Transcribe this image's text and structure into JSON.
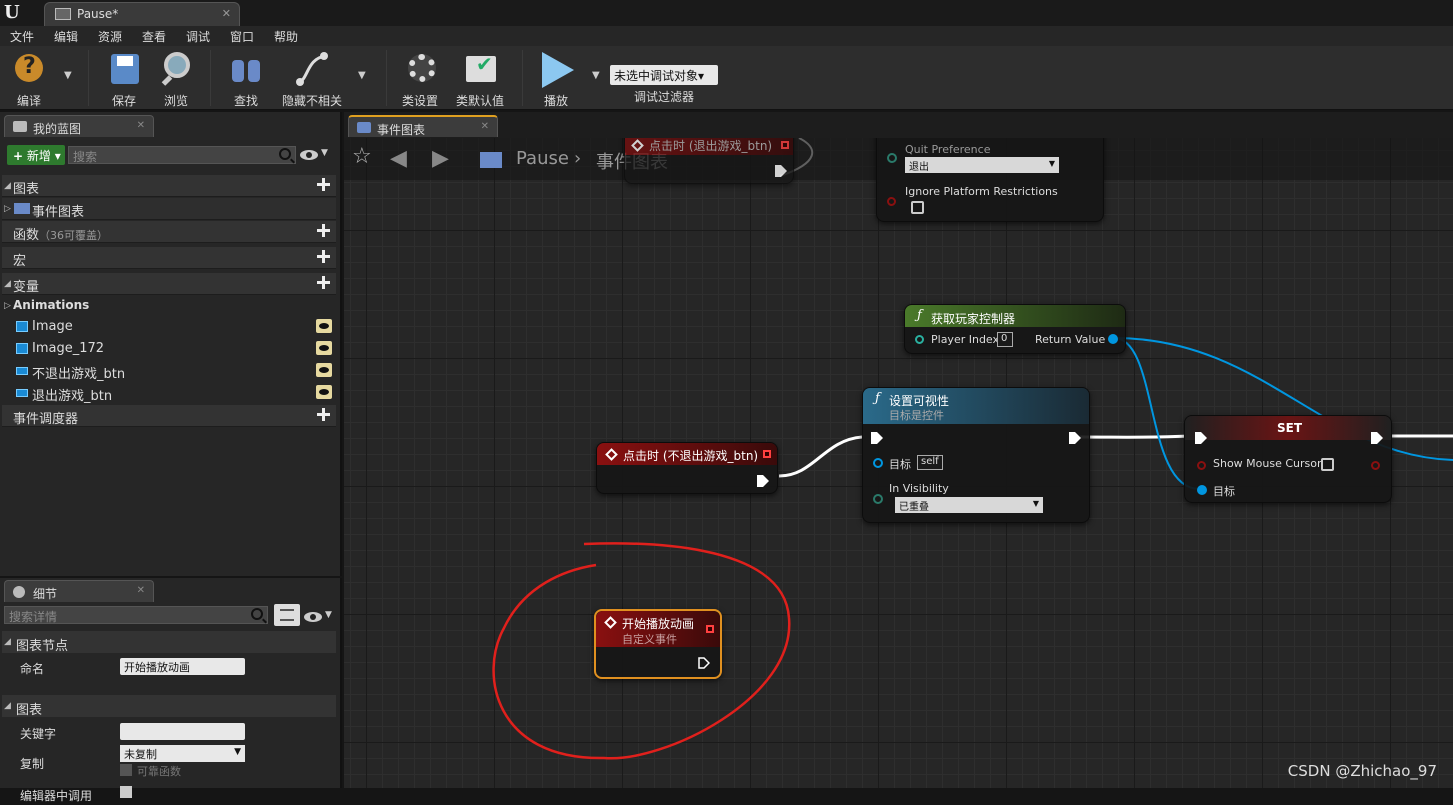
{
  "window": {
    "tab_title": "Pause*"
  },
  "menu": [
    "文件",
    "编辑",
    "资源",
    "查看",
    "调试",
    "窗口",
    "帮助"
  ],
  "toolbar": {
    "compile": "编译",
    "save": "保存",
    "browse": "浏览",
    "find": "查找",
    "hide_unrelated": "隐藏不相关",
    "class_settings": "类设置",
    "class_defaults": "类默认值",
    "play": "播放",
    "debug_object": "未选中调试对象▾",
    "debug_filter": "调试过滤器"
  },
  "my_blueprint": {
    "tab": "我的蓝图",
    "add_new": "新增",
    "search_placeholder": "搜索",
    "graphs": "图表",
    "event_graph": "事件图表",
    "functions": "函数",
    "functions_note": "（36可覆盖）",
    "macros": "宏",
    "variables": "变量",
    "animations": "Animations",
    "vars": [
      "Image",
      "Image_172",
      "不退出游戏_btn",
      "退出游戏_btn"
    ],
    "dispatchers": "事件调度器"
  },
  "details": {
    "tab": "细节",
    "search_placeholder": "搜索详情",
    "graph_node": "图表节点",
    "name_label": "命名",
    "name_value": "开始播放动画",
    "graph": "图表",
    "keywords": "关键字",
    "replication": "复制",
    "replication_value": "未复制",
    "reliable": "可靠函数",
    "editor_callable": "编辑器中调用"
  },
  "graph": {
    "tab": "事件图表",
    "bc_root": "Pause",
    "bc_sep": "›",
    "bc_leaf": "事件图表",
    "node_top_event": "点击时 (退出游戏_btn)",
    "quit_pref_label": "Quit Preference",
    "quit_pref_value": "退出",
    "ignore_label": "Ignore Platform Restrictions",
    "get_pc_title": "获取玩家控制器",
    "player_index": "Player Index",
    "player_index_value": "0",
    "return_value": "Return Value",
    "set_vis_title": "设置可视性",
    "set_vis_sub": "目标是控件",
    "target": "目标",
    "self": "self",
    "in_visibility": "In Visibility",
    "in_visibility_value": "已重叠",
    "set_title": "SET",
    "show_mouse": "Show Mouse Cursor",
    "click_event": "点击时 (不退出游戏_btn)",
    "custom_event_title": "开始播放动画",
    "custom_event_sub": "自定义事件"
  },
  "watermark": "CSDN @Zhichao_97",
  "colors": {
    "exec": "#ffffff",
    "object_pin": "#0096e0",
    "event_head": "#8a1010",
    "function_head": "#2a6a8a",
    "pure_head": "#4a7a2a",
    "annotation": "#e0201c"
  }
}
